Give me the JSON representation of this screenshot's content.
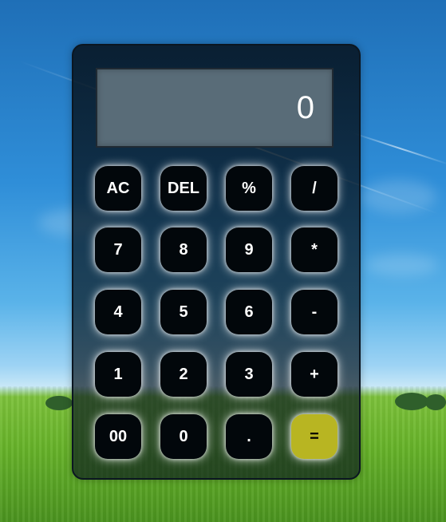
{
  "calculator": {
    "display_value": "0",
    "rows": [
      [
        "AC",
        "DEL",
        "%",
        "/"
      ],
      [
        "7",
        "8",
        "9",
        "*"
      ],
      [
        "4",
        "5",
        "6",
        "-"
      ],
      [
        "1",
        "2",
        "3",
        "+"
      ],
      [
        "00",
        "0",
        ".",
        "="
      ]
    ]
  },
  "colors": {
    "display_background": "#596c78",
    "button_background": "#02070b",
    "equals_background": "#b8b522",
    "button_text": "#ffffff"
  }
}
